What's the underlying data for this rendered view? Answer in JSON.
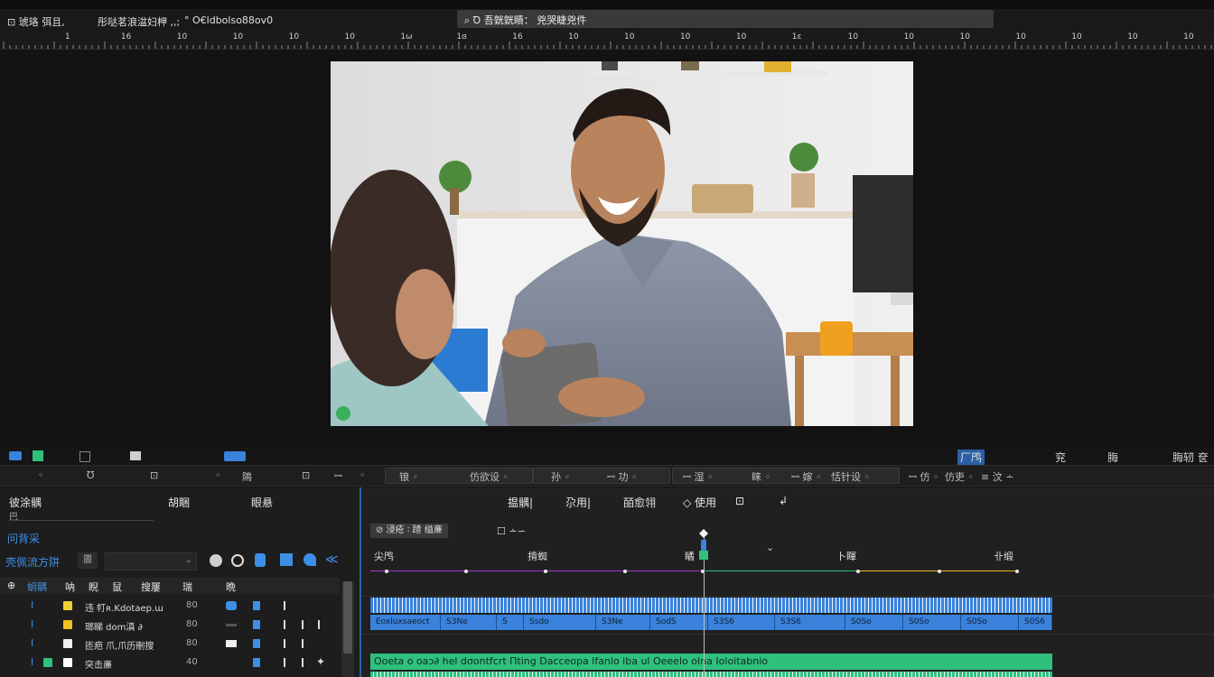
{
  "top": {
    "item1": "⊡  琥珞  弭且,",
    "item2": "彤哒茗浪湓妇柙 ,,;",
    "item3": "° O€ldbolso88ov0",
    "search": "⌕  Ꝺ 吾皝皝瞔：  兇哭睫兇件"
  },
  "ruler": {
    "labels": [
      "1",
      "16",
      "10",
      "10",
      "10",
      "10",
      "1ω",
      "1ɞ",
      "16",
      "10",
      "10",
      "10",
      "10",
      "1ε",
      "10",
      "10",
      "10",
      "10",
      "10",
      "10",
      "10"
    ]
  },
  "iconrow": {
    "right1": "厂鸤",
    "right2": "兖",
    "right3": "脢",
    "right4": "脢轫 奁"
  },
  "toolrow": {
    "items": [
      "◦",
      "℧",
      "⊡",
      "◦",
      "隝",
      "⊡",
      "ꟷ",
      "◦",
      "锒 ◦",
      "仿欲设 ◦",
      "孙 ◦",
      "ꟷ 功 ◦",
      "ꟷ 湿 ◦",
      "睐 ◦",
      "ꟷ 嫁 ◦",
      "恬针设 ◦",
      "ꟷ 仿 ◦",
      "仿吏 ◦",
      "≡ 汶 ∸"
    ]
  },
  "leftpanel": {
    "header1": "彼涂髃",
    "header2": "胡睏",
    "header3": "眼悬",
    "subheader": "巴",
    "section": "问背采",
    "toolbar_label": "壳佩流方阱",
    "toolbar_box": "圕",
    "cols": [
      "⊕",
      "蚏髃",
      "呐",
      "睨",
      "鼠",
      "搜屢",
      "瑞"
    ],
    "col_extra": "晩",
    "rows": [
      {
        "idx": "Ⅰ",
        "name": "违 帄ʀ.Kdotaep.ɯ",
        "num": "80",
        "color": "#f0d030"
      },
      {
        "idx": "Ⅰ",
        "name": "瑯睇 dom滇 ∂",
        "num": "80",
        "color": "#f0c020"
      },
      {
        "idx": "Ⅰ",
        "name": "匝疤 爪,爪历刪搜",
        "num": "80",
        "color": "#f0f0f0"
      },
      {
        "idx": "Ⅰ",
        "name": "突击亷",
        "num": "40",
        "color": "#ffffff"
      }
    ]
  },
  "timeline": {
    "header1": "揾髃|",
    "header2": "尕用|",
    "header3": "皕愈翎",
    "header4": "◇ 使用",
    "header5": "⊡",
    "header6": "↲",
    "chip": "⊘ 浸疮 ∶  蹅 缢亷",
    "chip2": "☐  ∸∽",
    "labels": [
      "尖鸤",
      "揹蜘",
      "瞲",
      "卜睴",
      "卜睴",
      "卝缎"
    ],
    "bluetrack_segments": [
      "Eoxluxsaeoct",
      "S3Ne",
      "S",
      "Ssdo",
      "S3Ne",
      "SodS",
      "S3S6",
      "S3S6",
      "S0So",
      "S0So",
      "S0So",
      "S0S6"
    ],
    "greentrack_text": "Ooeta ο oaɔ∂ hel dσontfcrt Πting Dacceopa lfanlo iba ul Oeeelo oIna Ioloitabnio"
  },
  "colors": {
    "accent_blue": "#3a82db",
    "accent_green": "#2fc07e",
    "purple": "#a035d9",
    "yellow": "#e3b72c"
  }
}
